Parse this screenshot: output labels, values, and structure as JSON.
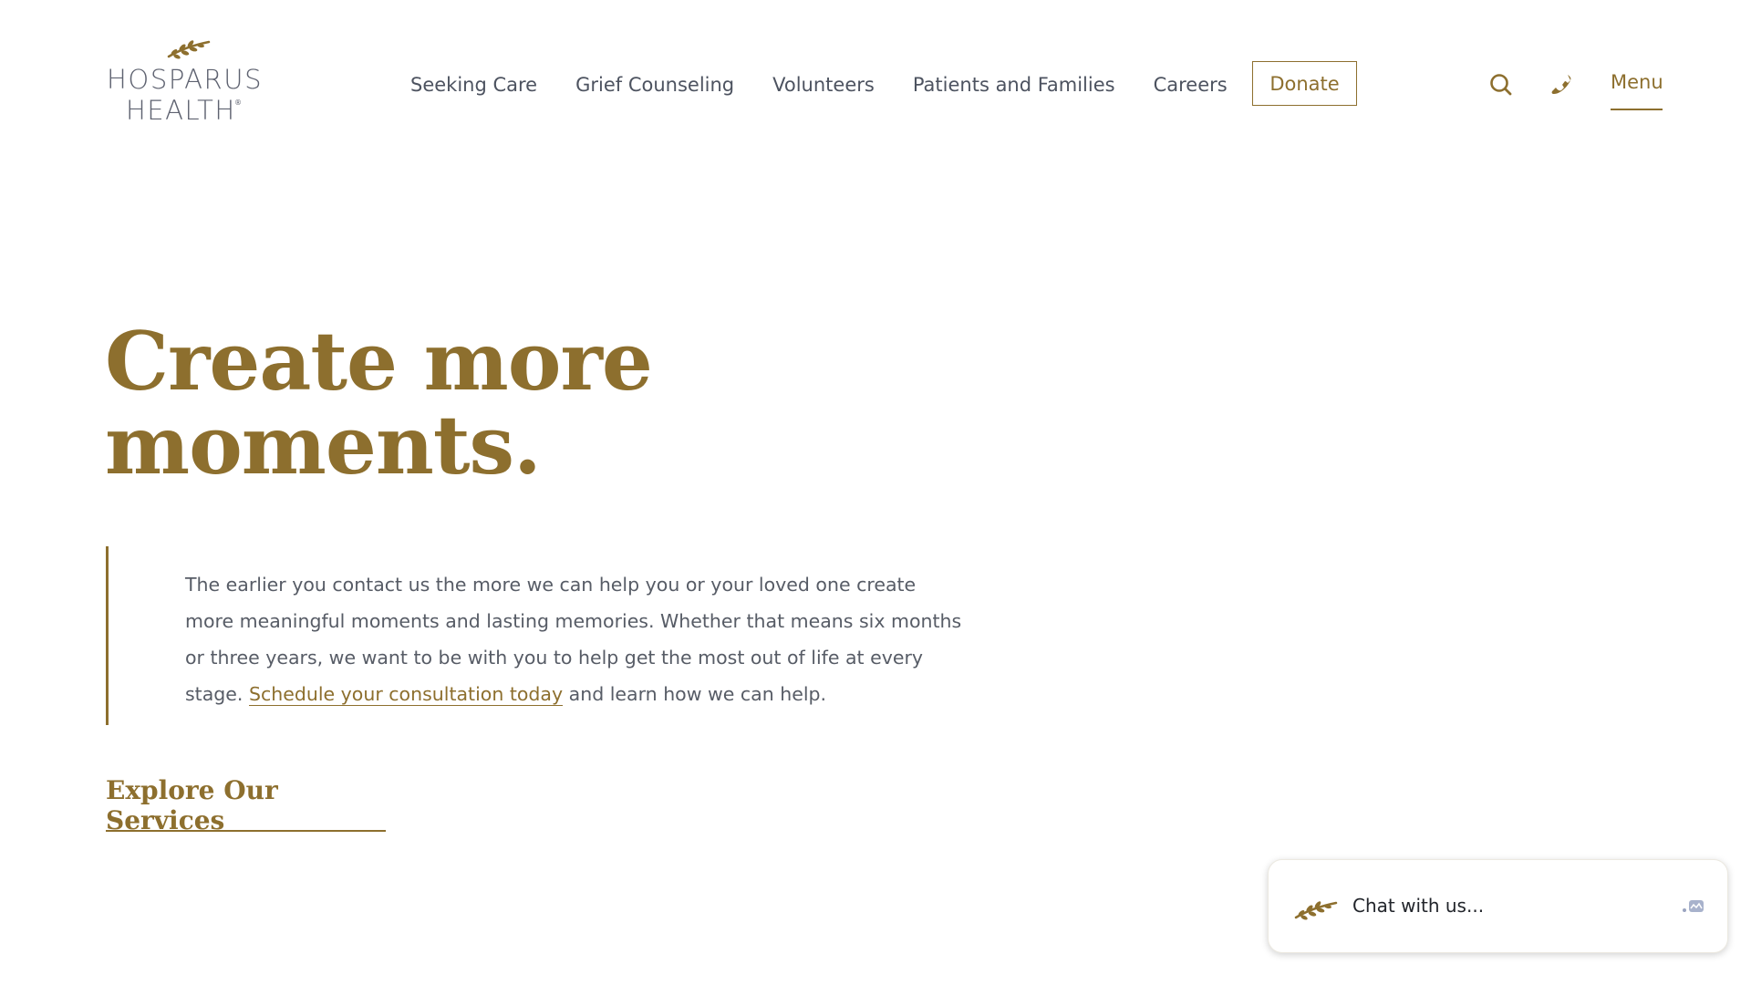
{
  "brand": {
    "line1": "HOSPARUS",
    "line2": "HEALTH",
    "reg": "®",
    "accent": "#8d6f2e",
    "text_gray": "#575c66"
  },
  "nav": {
    "items": [
      {
        "label": "Seeking Care"
      },
      {
        "label": "Grief Counseling"
      },
      {
        "label": "Volunteers"
      },
      {
        "label": "Patients and Families"
      },
      {
        "label": "Careers"
      }
    ],
    "donate_label": "Donate",
    "search_icon": "search-icon",
    "phone_icon": "phone-icon",
    "menu_label": "Menu"
  },
  "hero": {
    "title_line1": "Create more",
    "title_line2": "moments.",
    "body_before_link": "The earlier you contact us the more we can help you or your loved one create more meaningful moments and lasting memories. Whether that means six months or three years, we want to be with you to help get the most out of life at every stage. ",
    "link_label": "Schedule your consultation today",
    "body_after_link": " and learn how we can help.",
    "cta_label": "Explore Our Services"
  },
  "chat": {
    "label": "Chat with us...",
    "brand_icon": "olive-branch-icon",
    "status_icon": "chat-bubble-icon"
  }
}
